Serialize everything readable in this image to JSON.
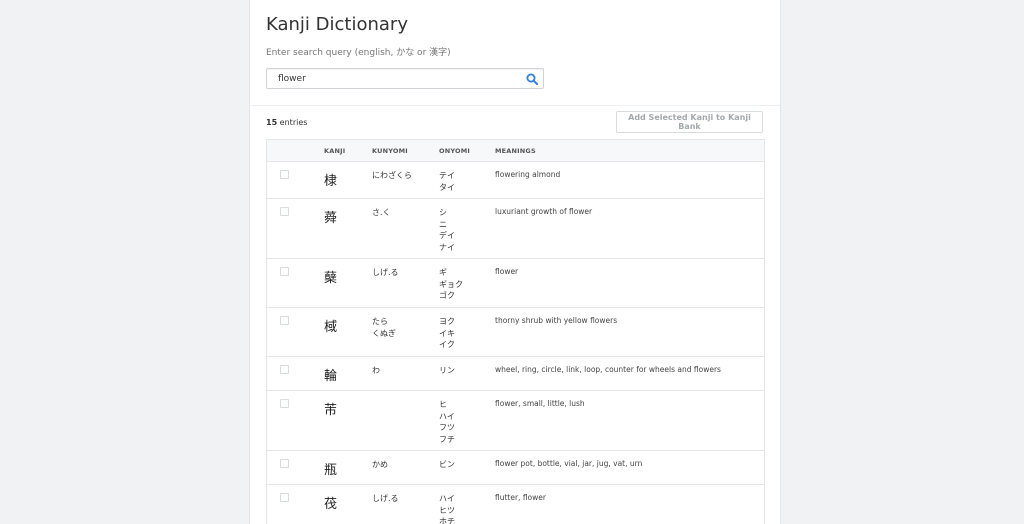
{
  "header": {
    "title": "Kanji Dictionary",
    "subtitle": "Enter search query (english, かな or 漢字)"
  },
  "search": {
    "value": "flower",
    "icon": "search-icon"
  },
  "results": {
    "count": "15",
    "count_suffix": " entries",
    "add_button_label": "Add Selected Kanji to Kanji Bank"
  },
  "table": {
    "columns": [
      "KANJI",
      "KUNYOMI",
      "ONYOMI",
      "MEANINGS"
    ],
    "rows": [
      {
        "kanji": "棣",
        "kunyomi": [
          "にわざくら"
        ],
        "onyomi": [
          "テイ",
          "タイ"
        ],
        "meanings": "flowering almond"
      },
      {
        "kanji": "蕣",
        "kunyomi": [
          "さ.く"
        ],
        "onyomi": [
          "シ",
          "ニ",
          "デイ",
          "ナイ"
        ],
        "meanings": "luxuriant growth of flower"
      },
      {
        "kanji": "蘖",
        "kunyomi": [
          "しげ.る"
        ],
        "onyomi": [
          "ギ",
          "ギョク",
          "ゴク"
        ],
        "meanings": "flower"
      },
      {
        "kanji": "棫",
        "kunyomi": [
          "たら",
          "くぬぎ"
        ],
        "onyomi": [
          "ヨク",
          "イキ",
          "イク"
        ],
        "meanings": "thorny shrub with yellow flowers"
      },
      {
        "kanji": "輪",
        "kunyomi": [
          "わ"
        ],
        "onyomi": [
          "リン"
        ],
        "meanings": "wheel, ring, circle, link, loop, counter for wheels and flowers"
      },
      {
        "kanji": "芾",
        "kunyomi": [],
        "onyomi": [
          "ヒ",
          "ハイ",
          "フツ",
          "フチ"
        ],
        "meanings": "flower, small, little, lush"
      },
      {
        "kanji": "瓶",
        "kunyomi": [
          "かめ"
        ],
        "onyomi": [
          "ビン"
        ],
        "meanings": "flower pot, bottle, vial, jar, jug, vat, urn"
      },
      {
        "kanji": "茷",
        "kunyomi": [
          "しげ.る"
        ],
        "onyomi": [
          "ハイ",
          "ヒツ",
          "ホチ"
        ],
        "meanings": "flutter, flower"
      }
    ]
  },
  "colors": {
    "page_bg": "#f1f2f4",
    "panel_bg": "#ffffff",
    "search_icon": "#2f7fd8",
    "border": "#e3e5e8"
  }
}
